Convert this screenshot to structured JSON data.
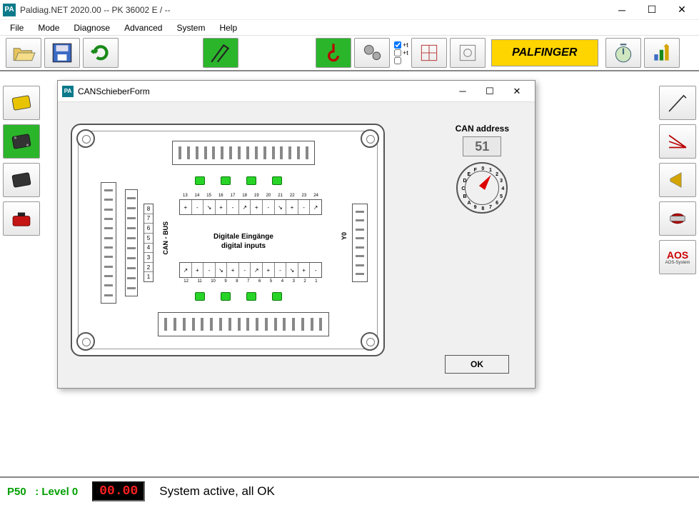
{
  "title": "Paldiag.NET  2020.00    -- PK 36002 E    /    --",
  "menu": [
    "File",
    "Mode",
    "Diagnose",
    "Advanced",
    "System",
    "Help"
  ],
  "toolbar_checks": [
    "+t",
    "+t"
  ],
  "brand": "PALFINGER",
  "status": {
    "p50": "P50",
    "level": ": Level 0",
    "counter": "00.00",
    "message": "System active, all OK"
  },
  "dialog": {
    "title": "CANSchieberForm",
    "can_label": "CAN address",
    "can_value": "51",
    "ok": "OK",
    "center_line1": "Digitale Eingänge",
    "center_line2": "digital inputs",
    "vlabel_can": "CAN - BUS",
    "vlabel_y0": "Y0",
    "rotary_marks": [
      "0",
      "1",
      "2",
      "3",
      "4",
      "5",
      "6",
      "7",
      "8",
      "9",
      "A",
      "B",
      "C",
      "D",
      "E",
      "F"
    ],
    "pin_top": [
      "13",
      "14",
      "15",
      "16",
      "17",
      "18",
      "19",
      "20",
      "21",
      "22",
      "23",
      "24"
    ],
    "pin_bot": [
      "12",
      "11",
      "10",
      "9",
      "8",
      "7",
      "6",
      "5",
      "4",
      "3",
      "2",
      "1"
    ],
    "left_row": [
      "1",
      "2",
      "3",
      "4",
      "5",
      "6",
      "7",
      "8"
    ]
  },
  "aos": {
    "l1": "AOS",
    "l2": "AOS-System"
  }
}
